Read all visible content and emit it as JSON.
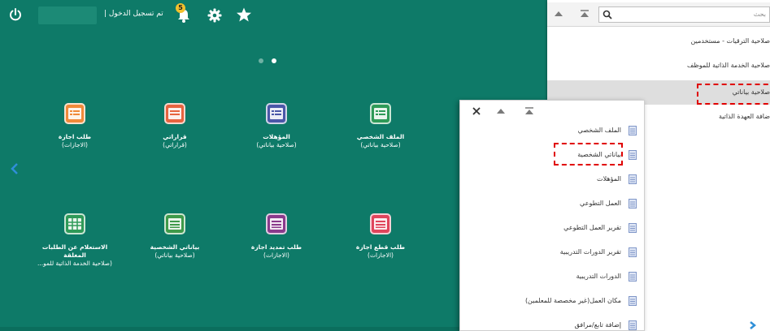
{
  "topbar": {
    "login_status": "تم تسجيل الدخول |",
    "notification_count": "5"
  },
  "tiles": [
    {
      "title": "طلب اجازة",
      "subtitle": "(الاجازات)",
      "color": "#f08a3a"
    },
    {
      "title": "قراراتي",
      "subtitle": "(قراراتي)",
      "color": "#e7643f"
    },
    {
      "title": "المؤهلات",
      "subtitle": "(صلاحية بياناتي)",
      "color": "#4a57a8"
    },
    {
      "title": "الملف الشخصي",
      "subtitle": "(صلاحية بياناتي)",
      "color": "#2f9a58"
    },
    {
      "title": "الاستعلام عن الطلبات المغلقة",
      "subtitle": "(صلاحية الخدمة الذاتية للمو...",
      "color": "#2f9a58"
    },
    {
      "title": "بياناتي الشخصية",
      "subtitle": "(صلاحية بياناتي)",
      "color": "#3f9a4a"
    },
    {
      "title": "طلب تمديد اجازة",
      "subtitle": "(الاجازات)",
      "color": "#8a3a8c"
    },
    {
      "title": "طلب قطع اجازة",
      "subtitle": "(الاجازات)",
      "color": "#e0455c"
    }
  ],
  "back_popup": {
    "search_placeholder": "بحث",
    "items": [
      "صلاحية الترقيات - مستخدمين",
      "صلاحية الخدمة الذاتية للموظف",
      "صلاحية بياناتي",
      "ضافة العهدة الذاتية"
    ]
  },
  "front_popup": {
    "items": [
      "الملف الشخصي",
      "بياناتي الشخصية",
      "المؤهلات",
      "العمل التطوعي",
      "تقرير العمل التطوعي",
      "تقرير الدورات التدريبية",
      "الدورات التدريبية",
      "مكان العمل(غير مخصصة للمعلمين)",
      "إضافة تابع/مرافق"
    ]
  },
  "colors": {
    "background": "#0e7a68",
    "highlight": "#e00000"
  }
}
